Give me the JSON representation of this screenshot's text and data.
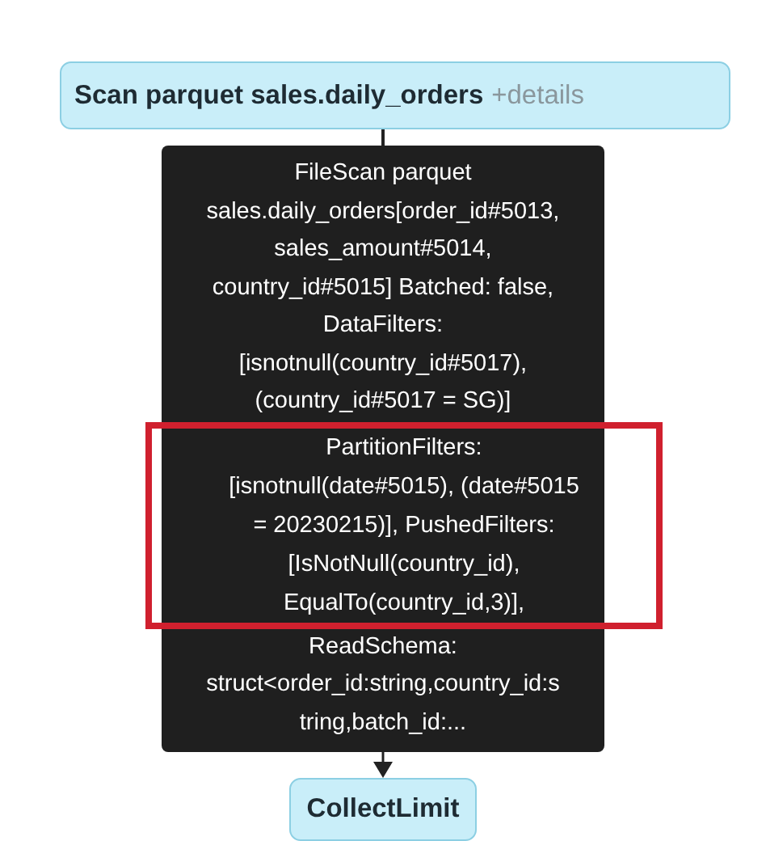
{
  "scan_node": {
    "title": "Scan parquet sales.daily_orders",
    "details_link": "+details"
  },
  "tooltip": {
    "sections": [
      {
        "highlighted": false,
        "lines": [
          "FileScan parquet",
          "sales.daily_orders[order_id#5013,",
          "sales_amount#5014,",
          "country_id#5015] Batched: false,",
          "DataFilters:",
          "[isnotnull(country_id#5017),",
          "(country_id#5017 = SG)]"
        ]
      },
      {
        "highlighted": true,
        "lines": [
          "PartitionFilters:",
          "[isnotnull(date#5015), (date#5015",
          "= 20230215)], PushedFilters:",
          "[IsNotNull(country_id),",
          "EqualTo(country_id,3)],"
        ]
      },
      {
        "highlighted": false,
        "lines": [
          "ReadSchema:",
          "struct<order_id:string,country_id:s",
          "tring,batch_id:..."
        ]
      }
    ]
  },
  "collect_node": {
    "title": "CollectLimit"
  }
}
